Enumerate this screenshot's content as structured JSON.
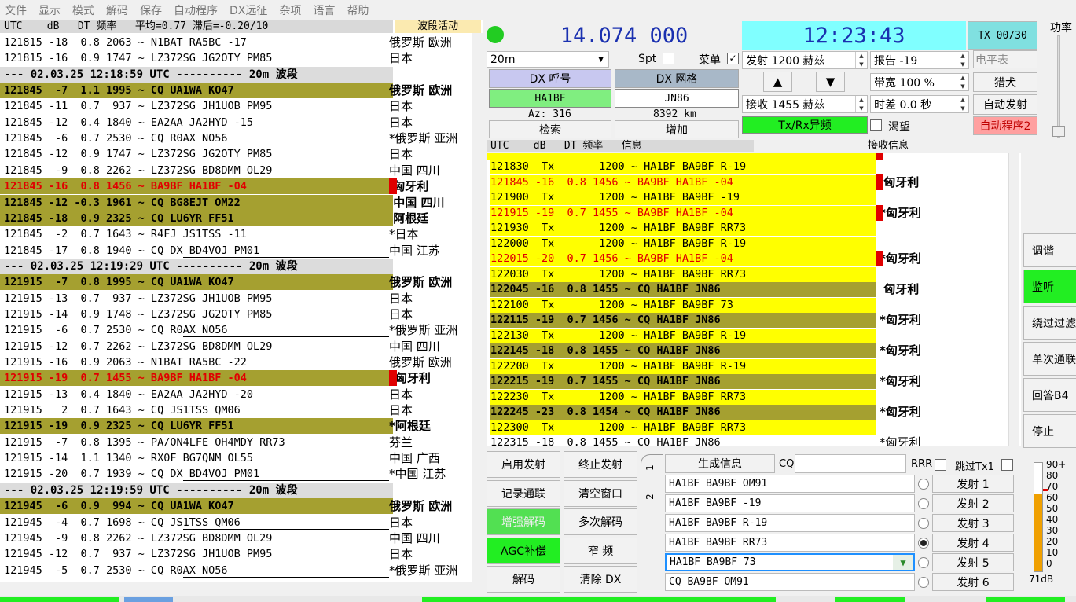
{
  "menu": [
    "文件",
    "显示",
    "模式",
    "解码",
    "保存",
    "自动程序",
    "DX远征",
    "杂项",
    "语言",
    "帮助"
  ],
  "left": {
    "header": "UTC    dB   DT 频率   平均=0.77 滞后=-0.20/10",
    "header_right": "波段活动",
    "rows": [
      {
        "t": "121815 -18  0.8 2063 ~ N1BAT RA5BC -17",
        "c": "俄罗斯 欧洲",
        "s": ""
      },
      {
        "t": "121815 -16  0.9 1747 ~ LZ372SG JG2OTY PM85",
        "c": "日本",
        "s": ""
      },
      {
        "t": "--- 02.03.25 12:18:59 UTC ---------- 20m 波段",
        "c": "",
        "s": "sep"
      },
      {
        "t": "121845  -7  1.1 1995 ~ CQ UA1WA KO47",
        "c": "俄罗斯 欧洲",
        "s": "olive"
      },
      {
        "t": "121845 -11  0.7  937 ~ LZ372SG JH1UOB PM95",
        "c": "日本",
        "s": ""
      },
      {
        "t": "121845 -12  0.4 1840 ~ EA2AA JA2HYD -15",
        "c": "日本",
        "s": ""
      },
      {
        "t": "121845  -6  0.7 2530 ~ CQ R0AX NO56",
        "c": "*俄罗斯 亚洲",
        "s": "ul"
      },
      {
        "t": "121845 -12  0.9 1747 ~ LZ372SG JG2OTY PM85",
        "c": "日本",
        "s": ""
      },
      {
        "t": "121845  -9  0.8 2262 ~ LZ372SG BD8DMM OL29",
        "c": "中国 四川",
        "s": ""
      },
      {
        "t": "121845 -16  0.8 1456 ~ BA9BF HA1BF -04",
        "c": " 匈牙利",
        "s": "red",
        "m": true
      },
      {
        "t": "121845 -12 -0.3 1961 ~ CQ BG8EJT OM22",
        "c": " 中国 四川",
        "s": "olive"
      },
      {
        "t": "121845 -18  0.9 2325 ~ CQ LU6YR FF51",
        "c": " 阿根廷",
        "s": "olive"
      },
      {
        "t": "121845  -2  0.7 1643 ~ R4FJ JS1TSS -11",
        "c": "*日本",
        "s": ""
      },
      {
        "t": "121845 -17  0.8 1940 ~ CQ DX BD4VOJ PM01",
        "c": "中国 江苏",
        "s": "ul"
      },
      {
        "t": "--- 02.03.25 12:19:29 UTC ---------- 20m 波段",
        "c": "",
        "s": "sep"
      },
      {
        "t": "121915  -7  0.8 1995 ~ CQ UA1WA KO47",
        "c": "俄罗斯 欧洲",
        "s": "olive"
      },
      {
        "t": "121915 -13  0.7  937 ~ LZ372SG JH1UOB PM95",
        "c": "日本",
        "s": ""
      },
      {
        "t": "121915 -14  0.9 1748 ~ LZ372SG JG2OTY PM85",
        "c": "日本",
        "s": ""
      },
      {
        "t": "121915  -6  0.7 2530 ~ CQ R0AX NO56",
        "c": "*俄罗斯 亚洲",
        "s": "ul"
      },
      {
        "t": "121915 -12  0.7 2262 ~ LZ372SG BD8DMM OL29",
        "c": "中国 四川",
        "s": ""
      },
      {
        "t": "121915 -16  0.9 2063 ~ N1BAT RA5BC -22",
        "c": "俄罗斯 欧洲",
        "s": ""
      },
      {
        "t": "121915 -19  0.7 1455 ~ BA9BF HA1BF -04",
        "c": "*匈牙利",
        "s": "red",
        "m": true
      },
      {
        "t": "121915 -13  0.4 1840 ~ EA2AA JA2HYD -20",
        "c": "日本",
        "s": ""
      },
      {
        "t": "121915   2  0.7 1643 ~ CQ JS1TSS QM06",
        "c": "日本",
        "s": "ul"
      },
      {
        "t": "121915 -19  0.9 2325 ~ CQ LU6YR FF51",
        "c": "*阿根廷",
        "s": "olive"
      },
      {
        "t": "121915  -7  0.8 1395 ~ PA/ON4LFE OH4MDY RR73",
        "c": "芬兰",
        "s": ""
      },
      {
        "t": "121915 -14  1.1 1340 ~ RX0F BG7QNM OL55",
        "c": "中国 广西",
        "s": ""
      },
      {
        "t": "121915 -20  0.7 1939 ~ CQ DX BD4VOJ PM01",
        "c": "*中国 江苏",
        "s": "ul"
      },
      {
        "t": "--- 02.03.25 12:19:59 UTC ---------- 20m 波段",
        "c": "",
        "s": "sep"
      },
      {
        "t": "121945  -6  0.9  994 ~ CQ UA1WA KO47",
        "c": "俄罗斯 欧洲",
        "s": "olive"
      },
      {
        "t": "121945  -4  0.7 1698 ~ CQ JS1TSS QM06",
        "c": "日本",
        "s": "ul"
      },
      {
        "t": "121945  -9  0.8 2262 ~ LZ372SG BD8DMM OL29",
        "c": "中国 四川",
        "s": ""
      },
      {
        "t": "121945 -12  0.7  937 ~ LZ372SG JH1UOB PM95",
        "c": "日本",
        "s": ""
      },
      {
        "t": "121945  -5  0.7 2530 ~ CQ R0AX NO56",
        "c": "*俄罗斯 亚洲",
        "s": "ul"
      }
    ]
  },
  "right": {
    "header": "UTC    dB   DT 频率   信息",
    "header_right": "接收信息",
    "rows": [
      {
        "t": "121830  Tx       1200 ~ HA1BF BA9BF R-19",
        "c": "",
        "s": "yel"
      },
      {
        "t": "121845 -16  0.8 1456 ~ BA9BF HA1BF -04",
        "c": " 匈牙利",
        "s": "yred",
        "m": true
      },
      {
        "t": "121900  Tx       1200 ~ HA1BF BA9BF -19",
        "c": "",
        "s": "yel"
      },
      {
        "t": "121915 -19  0.7 1455 ~ BA9BF HA1BF -04",
        "c": "*匈牙利",
        "s": "yred",
        "m": true
      },
      {
        "t": "121930  Tx       1200 ~ HA1BF BA9BF RR73",
        "c": "",
        "s": "yel"
      },
      {
        "t": "122000  Tx       1200 ~ HA1BF BA9BF R-19",
        "c": "",
        "s": "yel"
      },
      {
        "t": "122015 -20  0.7 1456 ~ BA9BF HA1BF -04",
        "c": "*匈牙利",
        "s": "yred",
        "m": true
      },
      {
        "t": "122030  Tx       1200 ~ HA1BF BA9BF RR73",
        "c": "",
        "s": "yel"
      },
      {
        "t": "122045 -16  0.8 1455 ~ CQ HA1BF JN86",
        "c": " 匈牙利",
        "s": "olv"
      },
      {
        "t": "122100  Tx       1200 ~ HA1BF BA9BF 73",
        "c": "",
        "s": "yel"
      },
      {
        "t": "122115 -19  0.7 1456 ~ CQ HA1BF JN86",
        "c": "*匈牙利",
        "s": "olv"
      },
      {
        "t": "122130  Tx       1200 ~ HA1BF BA9BF R-19",
        "c": "",
        "s": "yel"
      },
      {
        "t": "122145 -18  0.8 1455 ~ CQ HA1BF JN86",
        "c": "*匈牙利",
        "s": "olv"
      },
      {
        "t": "122200  Tx       1200 ~ HA1BF BA9BF R-19",
        "c": "",
        "s": "yel"
      },
      {
        "t": "122215 -19  0.7 1455 ~ CQ HA1BF JN86",
        "c": "*匈牙利",
        "s": "olv"
      },
      {
        "t": "122230  Tx       1200 ~ HA1BF BA9BF RR73",
        "c": "",
        "s": "yel"
      },
      {
        "t": "122245 -23  0.8 1454 ~ CQ HA1BF JN86",
        "c": "*匈牙利",
        "s": "olv"
      },
      {
        "t": "122300  Tx       1200 ~ HA1BF BA9BF RR73",
        "c": "",
        "s": "yel"
      },
      {
        "t": "122315 -18  0.8 1455 ~ CQ HA1BF JN86",
        "c": "*匈牙利",
        "s": "ul"
      }
    ]
  },
  "freq": "14.074 000",
  "clock": "12:23:43",
  "tx_counter": "TX 00/30",
  "power_label": "功率",
  "band": "20m",
  "spt": "Spt",
  "menu_chk": "菜单",
  "tx_freq": "发射  1200  赫兹",
  "rx_freq": "接收  1455  赫兹",
  "report": "报告 -19",
  "bandwidth": "带宽  100 %",
  "time_offset": "时差 0.0 秒",
  "level_meter": "电平表",
  "hound": "猎犬",
  "auto_tx": "自动发射",
  "auto_prog2": "自动程序2",
  "txrx_split": "Tx/Rx异频",
  "desire": "渴望",
  "dx_call_label": "DX 呼号",
  "dx_grid_label": "DX 网格",
  "dx_call": "HA1BF",
  "dx_grid": "JN86",
  "az": "Az: 316",
  "dist": "8392 km",
  "lookup": "检索",
  "add": "增加",
  "right_buttons": [
    "调谐",
    "监听",
    "绕过过滤",
    "单次通联",
    "回答B4",
    "停止"
  ],
  "bottom_buttons": [
    "启用发射",
    "终止发射",
    "记录通联",
    "清空窗口",
    "增强解码",
    "多次解码",
    "AGC补偿",
    "窄 频",
    "解码",
    "清除 DX"
  ],
  "gen_msg": "生成信息",
  "cq": "CQ",
  "rrr": "RRR",
  "skip_tx1": "跳过Tx1",
  "tab1": "1",
  "tab2": "2",
  "messages": [
    "HA1BF BA9BF OM91",
    "HA1BF BA9BF -19",
    "HA1BF BA9BF R-19",
    "HA1BF BA9BF RR73",
    "HA1BF BA9BF 73",
    "CQ BA9BF OM91"
  ],
  "tx_buttons": [
    "发射 1",
    "发射 2",
    "发射 3",
    "发射 4",
    "发射 5",
    "发射 6"
  ],
  "selected_msg": 3,
  "meter_ticks": [
    "90+",
    "80",
    "70",
    "60",
    "50",
    "40",
    "30",
    "20",
    "10",
    "0"
  ],
  "meter_db": "71dB",
  "meter_level": 0.71
}
